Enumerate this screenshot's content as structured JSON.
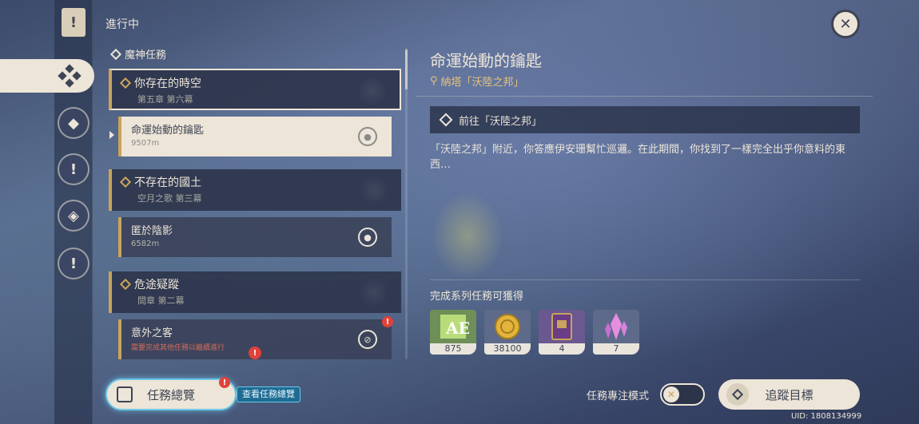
{
  "section": {
    "title": "進行中"
  },
  "group": {
    "label": "魔神任務"
  },
  "quests": [
    {
      "title": "你存在的時空",
      "subtitle": "第五章 第六幕",
      "step": {
        "title": "命運始動的鑰匙",
        "distance": "9507m",
        "action_icon": "map-pin-icon"
      }
    },
    {
      "title": "不存在的國土",
      "subtitle": "空月之歌 第三幕",
      "step": {
        "title": "匿於陰影",
        "distance": "6582m",
        "action_icon": "map-pin-icon"
      }
    },
    {
      "title": "危途疑蹤",
      "subtitle": "間章 第二幕",
      "step": {
        "title": "意外之客",
        "warning": "需要完成其他任務以繼續進行",
        "action_icon": "blocked-icon",
        "badge": "!"
      }
    }
  ],
  "detail": {
    "title": "命運始動的鑰匙",
    "location": "納塔「沃陸之邦」",
    "objective": "前往「沃陸之邦」",
    "description": "「沃陸之邦」附近，你答應伊安珊幫忙巡邏。在此期間，你找到了一樣完全出乎你意料的東西…",
    "rewards_label": "完成系列任務可獲得",
    "rewards": [
      {
        "name": "adventure-exp",
        "count": "875"
      },
      {
        "name": "mora",
        "count": "38100"
      },
      {
        "name": "heros-wit",
        "count": "4"
      },
      {
        "name": "primogem",
        "count": "7"
      }
    ]
  },
  "bottom": {
    "overview_label": "任務總覽",
    "overview_tip": "查看任務總覽",
    "overview_badge": "!",
    "focus_mode_label": "任務專注模式",
    "focus_mode_on": false,
    "track_label": "追蹤目標",
    "uid": "UID: 1808134999"
  },
  "colors": {
    "accent_gold": "#c9a45a",
    "cream": "#ece5d8",
    "location_gold": "#e6c27a",
    "highlight_blue": "#6fc6e6",
    "alert_red": "#e0423a"
  }
}
